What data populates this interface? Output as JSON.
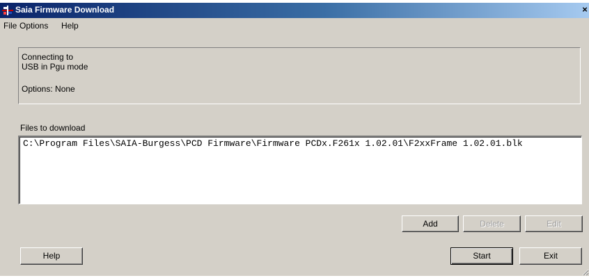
{
  "window": {
    "title": "Saia Firmware Download",
    "close_glyph": "×"
  },
  "menu": {
    "items": [
      "File",
      "Options",
      "Help"
    ]
  },
  "connection": {
    "line1": "Connecting to",
    "line2": "USB in Pgu mode",
    "options": "Options: None"
  },
  "files": {
    "label": "Files to download",
    "items": [
      "C:\\Program Files\\SAIA-Burgess\\PCD Firmware\\Firmware PCDx.F261x 1.02.01\\F2xxFrame 1.02.01.blk"
    ]
  },
  "buttons": {
    "add": "Add",
    "delete": "Delete",
    "edit": "Edit",
    "help": "Help",
    "start": "Start",
    "exit": "Exit"
  },
  "icons": {
    "app": "saia-app-icon",
    "close": "close-icon",
    "grip": "resize-grip-icon"
  },
  "colors": {
    "titlebar_start": "#0a246a",
    "titlebar_end": "#a6caf0",
    "face": "#d4d0c8"
  }
}
